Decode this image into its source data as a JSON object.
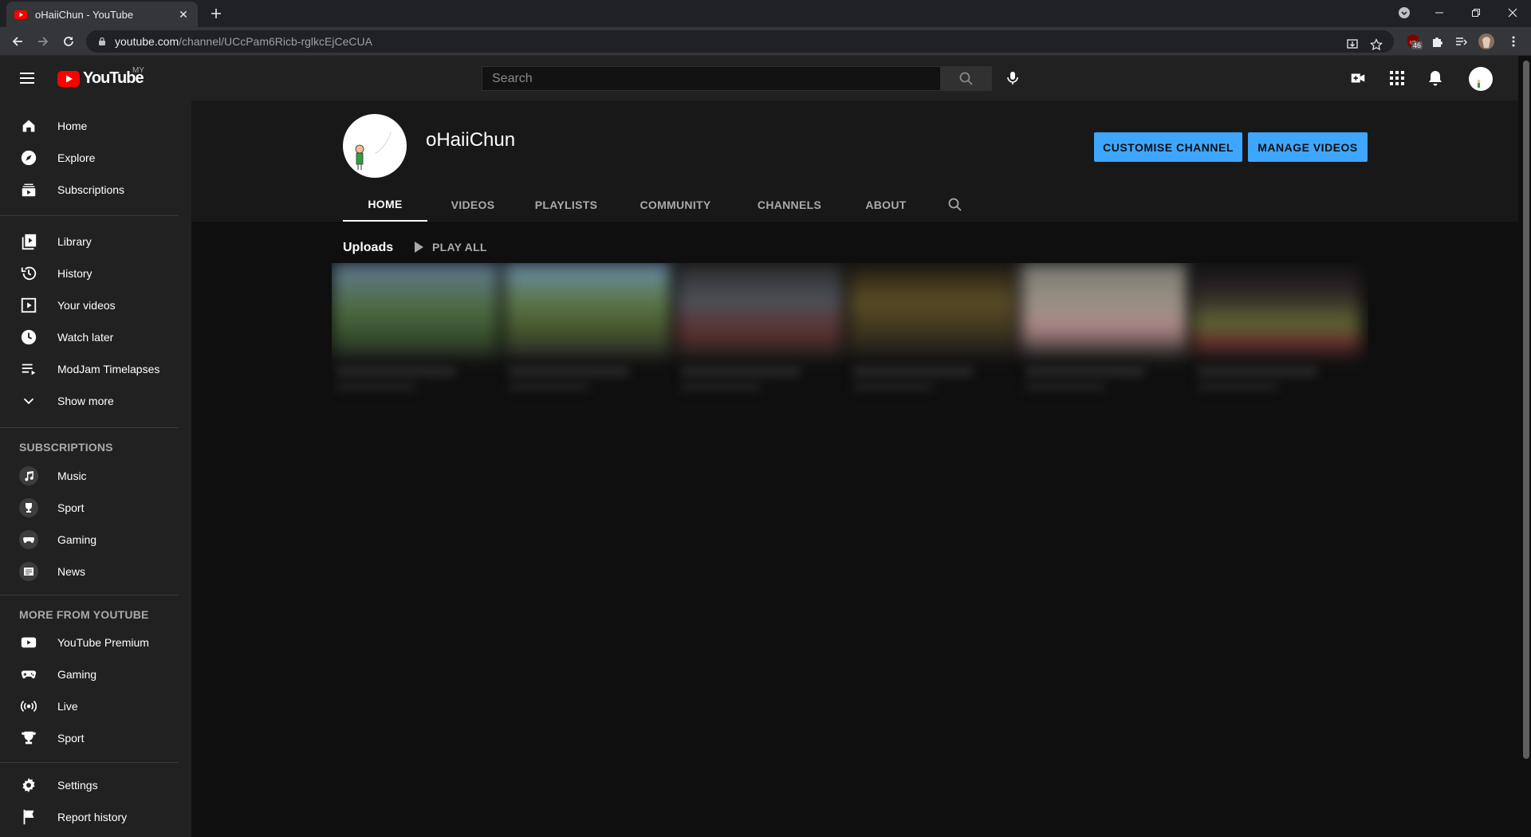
{
  "browser": {
    "tab_title": "oHaiiChun - YouTube",
    "url_host": "youtube.com",
    "url_path": "/channel/UCcPam6Ricb-rglkcEjCeCUA",
    "extension_badge": "46"
  },
  "masthead": {
    "logo_text": "YouTube",
    "country_code": "MY",
    "search_placeholder": "Search"
  },
  "sidebar": {
    "main": [
      {
        "label": "Home",
        "icon": "home-icon"
      },
      {
        "label": "Explore",
        "icon": "compass-icon"
      },
      {
        "label": "Subscriptions",
        "icon": "subscriptions-icon"
      }
    ],
    "library": [
      {
        "label": "Library",
        "icon": "library-icon"
      },
      {
        "label": "History",
        "icon": "history-icon"
      },
      {
        "label": "Your videos",
        "icon": "your-videos-icon"
      },
      {
        "label": "Watch later",
        "icon": "clock-icon"
      },
      {
        "label": "ModJam Timelapses",
        "icon": "playlist-icon"
      },
      {
        "label": "Show more",
        "icon": "chevron-down-icon"
      }
    ],
    "subscriptions_heading": "SUBSCRIPTIONS",
    "subscriptions": [
      {
        "label": "Music",
        "icon": "music-icon"
      },
      {
        "label": "Sport",
        "icon": "trophy-icon"
      },
      {
        "label": "Gaming",
        "icon": "gamepad-icon"
      },
      {
        "label": "News",
        "icon": "news-icon"
      }
    ],
    "more_heading": "MORE FROM YOUTUBE",
    "more": [
      {
        "label": "YouTube Premium",
        "icon": "youtube-icon"
      },
      {
        "label": "Gaming",
        "icon": "gamepad-icon"
      },
      {
        "label": "Live",
        "icon": "live-icon"
      },
      {
        "label": "Sport",
        "icon": "trophy-icon"
      }
    ],
    "footer": [
      {
        "label": "Settings",
        "icon": "gear-icon"
      },
      {
        "label": "Report history",
        "icon": "flag-icon"
      }
    ]
  },
  "channel": {
    "name": "oHaiiChun",
    "customise_label": "CUSTOMISE CHANNEL",
    "manage_label": "MANAGE VIDEOS",
    "tabs": [
      "HOME",
      "VIDEOS",
      "PLAYLISTS",
      "COMMUNITY",
      "CHANNELS",
      "ABOUT"
    ],
    "active_tab": "HOME"
  },
  "content": {
    "shelf_title": "Uploads",
    "play_all_label": "PLAY ALL"
  },
  "colors": {
    "accent_blue": "#3ea6ff",
    "youtube_red": "#ff0000",
    "surface": "#212121",
    "background": "#0f0f0f"
  }
}
